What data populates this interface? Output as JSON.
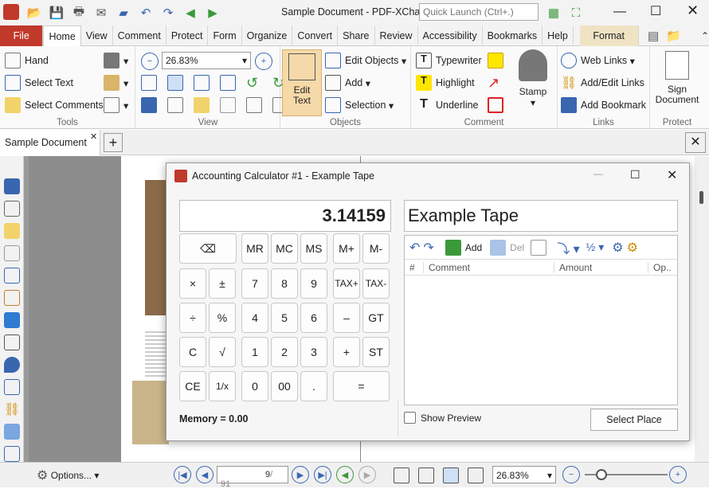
{
  "title": "Sample Document - PDF-XCha...",
  "search": {
    "placeholder": "Quick Launch (Ctrl+.)"
  },
  "menu": [
    "File",
    "Home",
    "View",
    "Comment",
    "Protect",
    "Form",
    "Organize",
    "Convert",
    "Share",
    "Review",
    "Accessibility",
    "Bookmarks",
    "Help",
    "Format"
  ],
  "ribbon": {
    "tools": {
      "label": "Tools",
      "hand": "Hand",
      "select_text": "Select Text",
      "select_comments": "Select Comments"
    },
    "view": {
      "label": "View",
      "zoom": "26.83%"
    },
    "objects": {
      "label": "Objects",
      "edit_text": "Edit Text",
      "edit_objects": "Edit Objects",
      "add": "Add",
      "selection": "Selection"
    },
    "comment": {
      "label": "Comment",
      "typewriter": "Typewriter",
      "highlight": "Highlight",
      "underline": "Underline",
      "stamp": "Stamp"
    },
    "links": {
      "label": "Links",
      "web_links": "Web Links",
      "add_edit_links": "Add/Edit Links",
      "add_bookmark": "Add Bookmark"
    },
    "protect": {
      "label": "Protect",
      "sign_document": "Sign Document"
    }
  },
  "doc_tab": "Sample Document",
  "dialog": {
    "title": "Accounting Calculator #1 - Example Tape",
    "display": "3.14159",
    "memory": "Memory = 0.00",
    "tape_name": "Example Tape",
    "toolbar": {
      "add": "Add",
      "del": "Del"
    },
    "columns": [
      "#",
      "Comment",
      "Amount",
      "Op.."
    ],
    "show_preview": "Show Preview",
    "select_place": "Select Place",
    "keys": [
      "⌫",
      "MR",
      "MC",
      "MS",
      "M+",
      "M-",
      "×",
      "±",
      "7",
      "8",
      "9",
      "TAX+",
      "TAX-",
      "÷",
      "%",
      "4",
      "5",
      "6",
      "–",
      "GT",
      "C",
      "√",
      "1",
      "2",
      "3",
      "+",
      "ST",
      "CE",
      "1/x",
      "0",
      "00",
      ".",
      "="
    ]
  },
  "status": {
    "options": "Options...",
    "page": "9",
    "pages": "/ 91",
    "zoom": "26.83%"
  },
  "colors": {
    "file_red": "#c0392b",
    "accent_blue": "#3a66b0",
    "highlight_yellow": "#ffe600"
  }
}
